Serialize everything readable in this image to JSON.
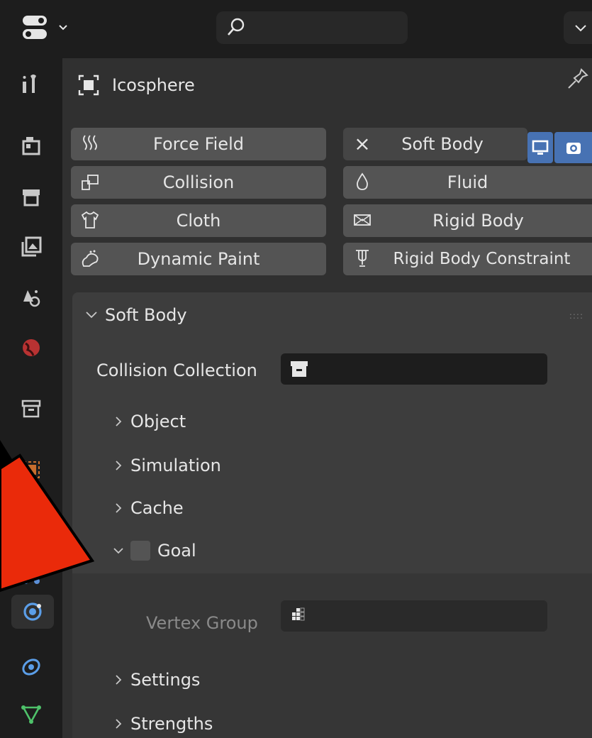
{
  "header": {
    "editor_icon": "properties-editor-icon",
    "search_icon": "search-icon",
    "search_placeholder": "",
    "dropdown_icon": "chevron-down-icon"
  },
  "tabs": [
    {
      "name": "tool-tab",
      "icon": "tool-icon"
    },
    {
      "name": "render-tab",
      "icon": "render-icon"
    },
    {
      "name": "output-tab",
      "icon": "output-icon"
    },
    {
      "name": "view-layer-tab",
      "icon": "view-layer-icon"
    },
    {
      "name": "scene-tab",
      "icon": "scene-icon"
    },
    {
      "name": "world-tab",
      "icon": "world-icon"
    },
    {
      "name": "collection-tab",
      "icon": "collection-icon"
    },
    {
      "name": "object-tab",
      "icon": "object-icon"
    },
    {
      "name": "modifier-tab",
      "icon": "wrench-icon"
    },
    {
      "name": "physics-tab",
      "icon": "physics-icon",
      "active": true
    },
    {
      "name": "constraints-tab",
      "icon": "constraint-icon"
    },
    {
      "name": "data-tab",
      "icon": "mesh-data-icon"
    }
  ],
  "object": {
    "name": "Icosphere"
  },
  "physics_buttons": {
    "force_field": "Force Field",
    "collision": "Collision",
    "cloth": "Cloth",
    "dynamic_paint": "Dynamic Paint",
    "soft_body": "Soft Body",
    "fluid": "Fluid",
    "rigid_body": "Rigid Body",
    "rigid_body_constraint": "Rigid Body Constraint",
    "remove_symbol": "×"
  },
  "soft_body_panel": {
    "title": "Soft Body",
    "collision_collection_label": "Collision Collection",
    "subpanels": {
      "object": "Object",
      "simulation": "Simulation",
      "cache": "Cache",
      "goal": "Goal",
      "settings": "Settings",
      "strengths": "Strengths"
    },
    "goal_enabled": false,
    "vertex_group_label": "Vertex Group"
  },
  "colors": {
    "accent_toggle": "#4772b3",
    "arrow": "#ea2a0a"
  }
}
